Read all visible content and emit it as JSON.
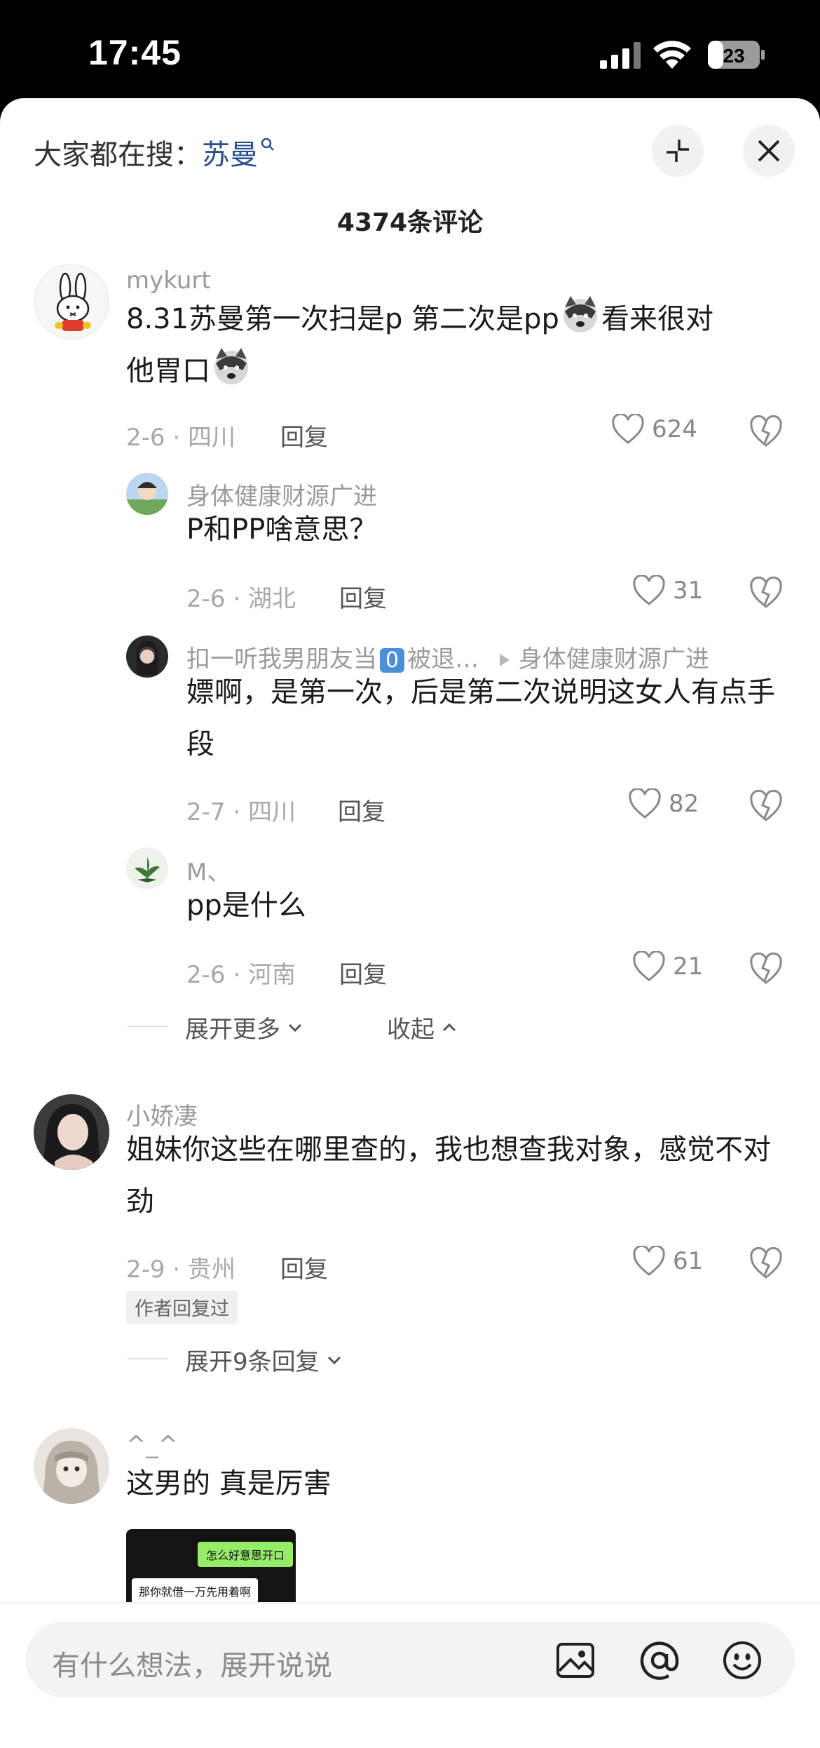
{
  "status_bar": {
    "time": "17:45",
    "battery": "23"
  },
  "header": {
    "search_prefix": "大家都在搜：",
    "search_keyword": "苏曼",
    "comments_count": "4374条评论"
  },
  "comments": [
    {
      "user": "mykurt",
      "text_part1": "8.31苏曼第一次扫是p 第二次是pp",
      "text_part2": "看来很对",
      "text_part3": "他胃口",
      "meta": "2-6 · 四川",
      "reply": "回复",
      "likes": "624",
      "replies": [
        {
          "user": "身体健康财源广进",
          "text": "P和PP啥意思？",
          "meta": "2-6 · 湖北",
          "reply": "回复",
          "likes": "31"
        },
        {
          "user_from": "扣一听我男朋友当",
          "user_badge": "0",
          "user_suffix": "被退…",
          "user_to": "身体健康财源广进",
          "text": "嫖啊，是第一次，后是第二次说明这女人有点手段",
          "meta": "2-7 · 四川",
          "reply": "回复",
          "likes": "82"
        },
        {
          "user": "M、",
          "text": "pp是什么",
          "meta": "2-6 · 河南",
          "reply": "回复",
          "likes": "21"
        }
      ],
      "expand_more": "展开更多",
      "collapse": "收起"
    },
    {
      "user": "小娇凄",
      "text": "姐妹你这些在哪里查的，我也想查我对象，感觉不对劲",
      "meta": "2-9 · 贵州",
      "reply": "回复",
      "likes": "61",
      "author_badge": "作者回复过",
      "expand_replies": "展开9条回复"
    },
    {
      "user": "^_^",
      "text": "这男的 真是厉害",
      "image_bubble_1": "怎么好意思开口",
      "image_bubble_2": "那你就借一万先用着啊"
    }
  ],
  "input": {
    "placeholder": "有什么想法，展开说说"
  },
  "colors": {
    "keyword": "#2b4f8e",
    "background": "#ffffff",
    "muted": "#a8a8a8"
  }
}
